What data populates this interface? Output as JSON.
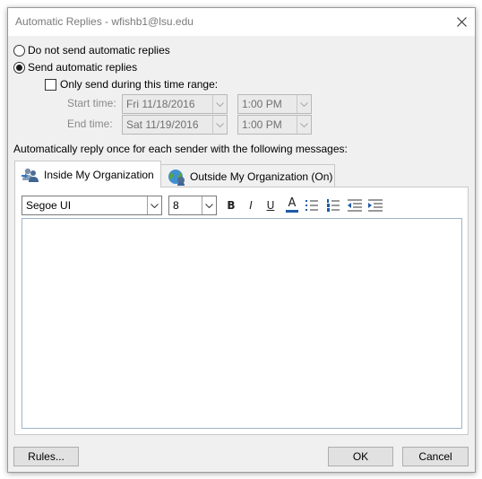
{
  "window": {
    "title": "Automatic Replies - wfishb1@lsu.edu"
  },
  "options": {
    "no_reply": "Do not send automatic replies",
    "send_reply": "Send automatic replies",
    "only_range": "Only send during this time range:",
    "start_label": "Start time:",
    "end_label": "End time:",
    "start_date": "Fri 11/18/2016",
    "start_time": "1:00 PM",
    "end_date": "Sat 11/19/2016",
    "end_time": "1:00 PM",
    "selected": "send_reply",
    "only_range_checked": false
  },
  "message_caption": "Automatically reply once for each sender with the following messages:",
  "tabs": [
    {
      "label": "Inside My Organization",
      "icon": "people-icon",
      "active": true
    },
    {
      "label": "Outside My Organization (On)",
      "icon": "globe-icon",
      "active": false
    }
  ],
  "toolbar": {
    "font": "Segoe UI",
    "size": "8",
    "bold": "B",
    "italic": "I",
    "underline": "U",
    "font_color": "A",
    "font_color_hex": "#1e5aa8"
  },
  "editor": {
    "text": ""
  },
  "buttons": {
    "rules": "Rules...",
    "ok": "OK",
    "cancel": "Cancel"
  }
}
